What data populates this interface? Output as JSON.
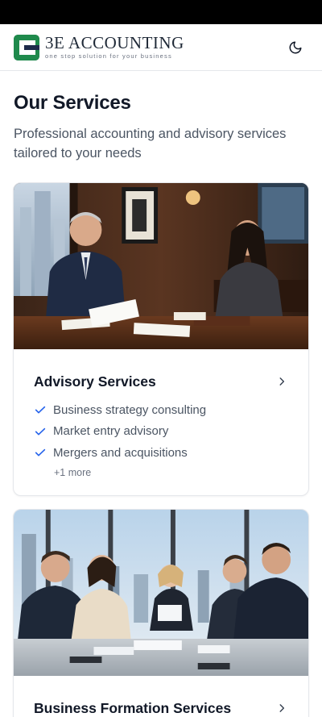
{
  "header": {
    "logo_name": "3E ACCOUNTING",
    "logo_tagline": "one stop solution for your business",
    "brand_green": "#1f8a4c",
    "brand_navy": "#1e2a4a",
    "theme_toggle_icon": "moon-icon"
  },
  "page": {
    "title": "Our Services",
    "subtitle": "Professional accounting and advisory services tailored to your needs"
  },
  "services": [
    {
      "title": "Advisory Services",
      "image_icon": "advisory-meeting-photo",
      "features": [
        "Business strategy consulting",
        "Market entry advisory",
        "Mergers and acquisitions"
      ],
      "more": "+1 more"
    },
    {
      "title": "Business Formation Services",
      "image_icon": "business-formation-meeting-photo"
    }
  ],
  "colors": {
    "accent": "#2563eb",
    "text_primary": "#111827",
    "text_secondary": "#4b5563"
  }
}
